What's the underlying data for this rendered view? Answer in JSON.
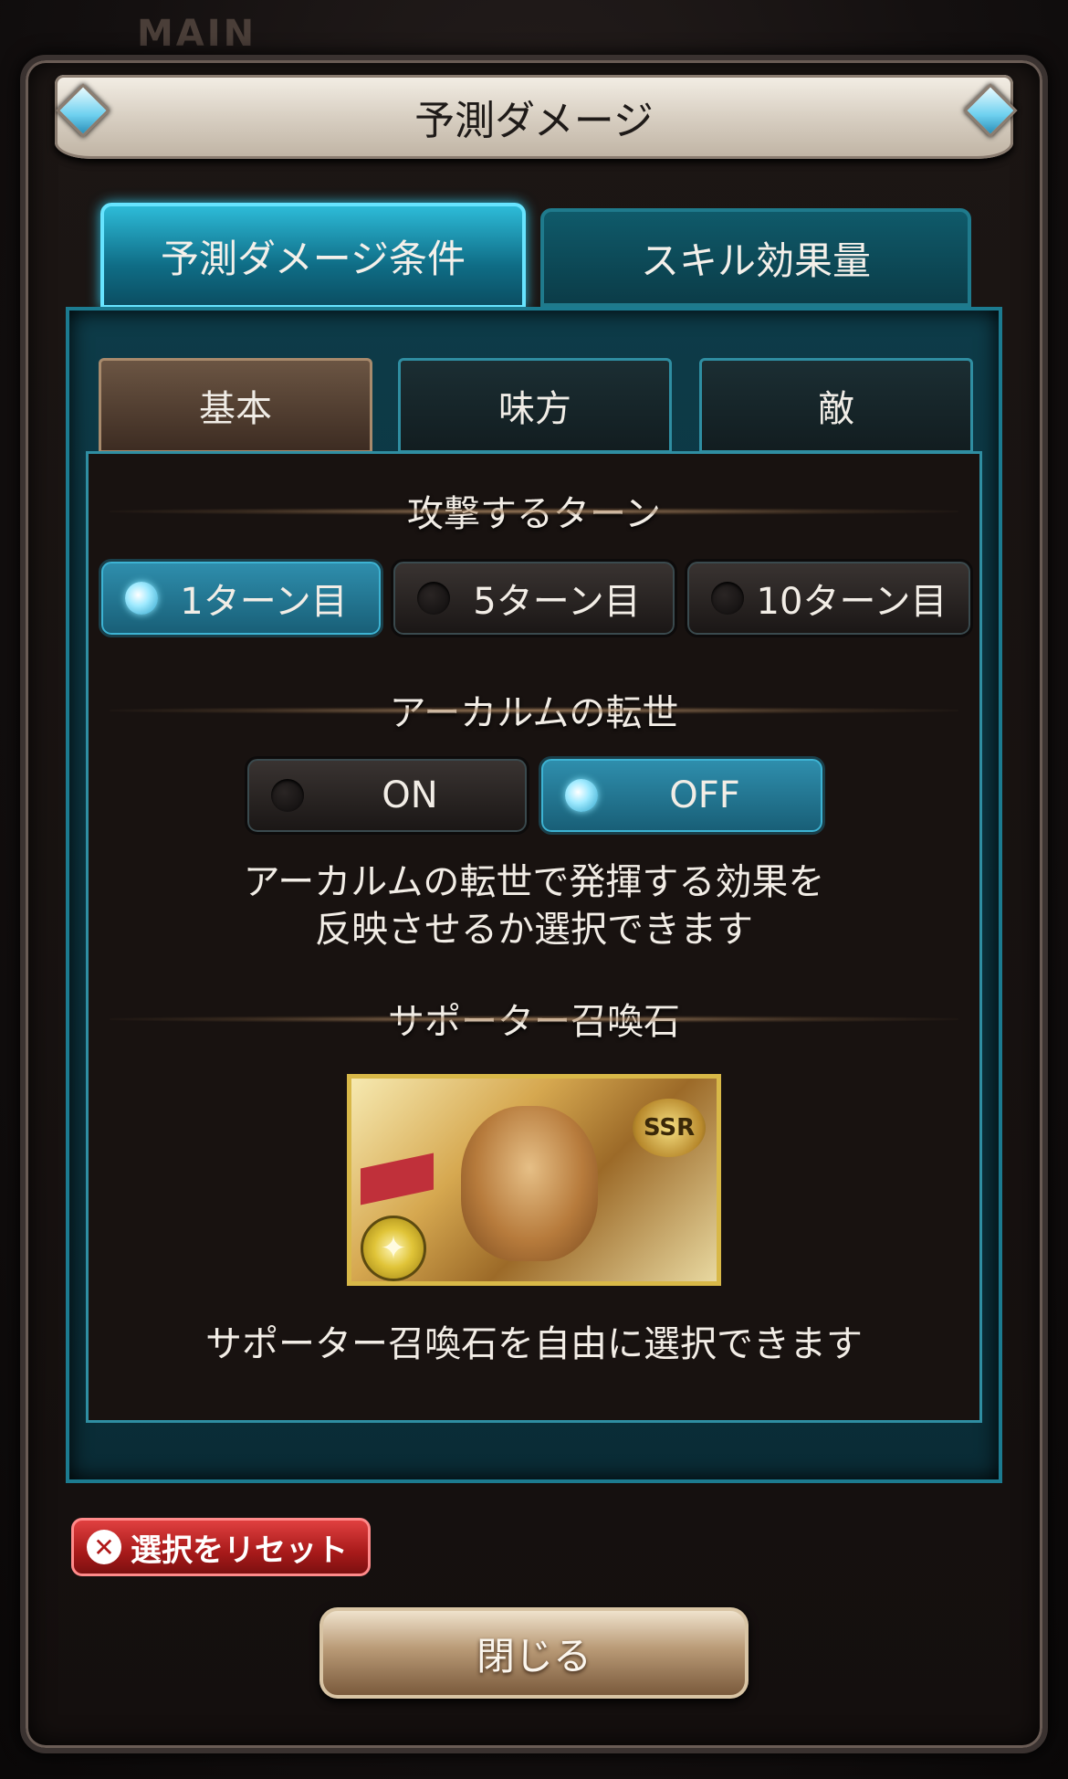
{
  "background": {
    "label": "MAIN"
  },
  "dialog": {
    "title": "予測ダメージ"
  },
  "top_tabs": [
    {
      "label": "予測ダメージ条件",
      "active": true
    },
    {
      "label": "スキル効果量",
      "active": false
    }
  ],
  "sub_tabs": [
    {
      "label": "基本",
      "active": true
    },
    {
      "label": "味方",
      "active": false
    },
    {
      "label": "敵",
      "active": false
    }
  ],
  "attack_turn": {
    "title": "攻撃するターン",
    "options": [
      {
        "label": "1ターン目",
        "selected": true
      },
      {
        "label": "5ターン目",
        "selected": false
      },
      {
        "label": "10ターン目",
        "selected": false
      }
    ]
  },
  "arcarum": {
    "title": "アーカルムの転世",
    "options": [
      {
        "label": "ON",
        "selected": false
      },
      {
        "label": "OFF",
        "selected": true
      }
    ],
    "description_line1": "アーカルムの転世で発揮する効果を",
    "description_line2": "反映させるか選択できます"
  },
  "supporter": {
    "title": "サポーター召喚石",
    "rarity": "SSR",
    "element_icon": "light-element-icon",
    "description": "サポーター召喚石を自由に選択できます"
  },
  "actions": {
    "reset_label": "選択をリセット",
    "close_label": "閉じる"
  },
  "colors": {
    "accent_cyan": "#2dbbd8",
    "reset_red": "#c02020",
    "active_subtab": "#6b5543"
  }
}
